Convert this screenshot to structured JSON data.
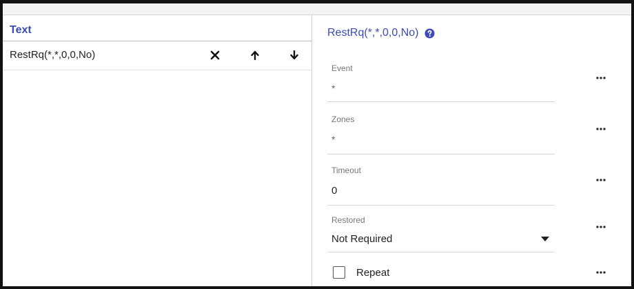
{
  "list_panel": {
    "header": "Text",
    "items": [
      {
        "label": "RestRq(*,*,0,0,No)"
      }
    ],
    "icons": {
      "remove": "close-icon",
      "move_up": "arrow-up-icon",
      "move_down": "arrow-down-icon"
    }
  },
  "detail_panel": {
    "title": "RestRq(*,*,0,0,No)",
    "help_icon": "question-circle-icon",
    "fields": [
      {
        "label": "Event",
        "value": "*"
      },
      {
        "label": "Zones",
        "value": "*"
      },
      {
        "label": "Timeout",
        "value": "0"
      },
      {
        "label": "Restored",
        "value": "Not Required"
      }
    ],
    "repeat": {
      "label": "Repeat",
      "checked": false
    }
  },
  "colors": {
    "accent": "#3d4bb7",
    "border": "#111111"
  }
}
